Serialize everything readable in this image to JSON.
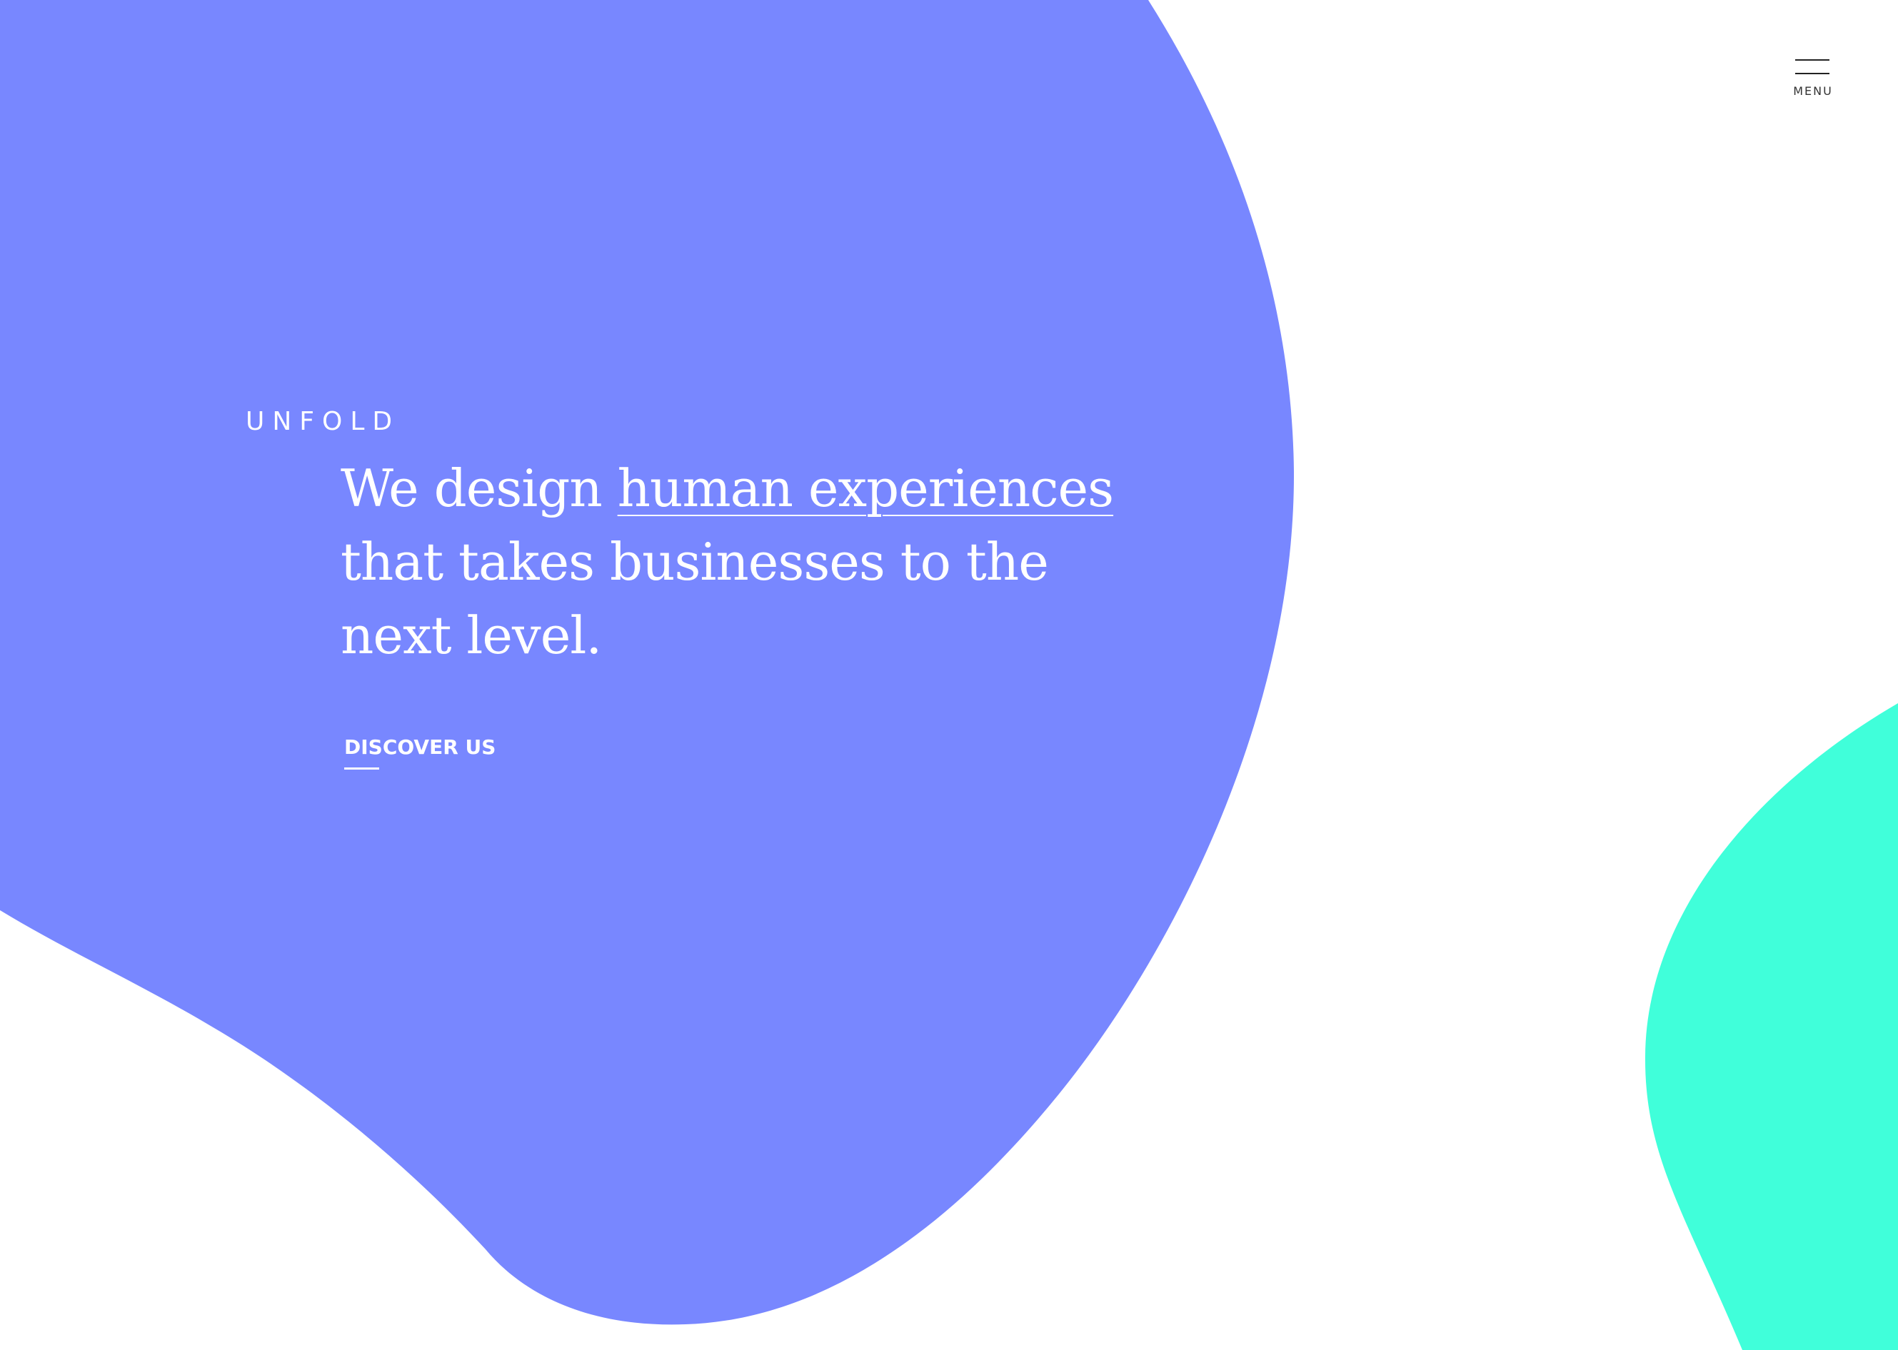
{
  "colors": {
    "primary_blob": "#7887FF",
    "accent_blob": "#40FFDA",
    "background": "#FFFFFF",
    "text_on_primary": "#FFFFFF",
    "menu_ink": "#222222"
  },
  "header": {
    "menu_icon": "hamburger-menu-icon",
    "menu_label": "MENU"
  },
  "hero": {
    "brand": "UNFOLD",
    "headline_pre": "We design ",
    "headline_highlight": "human experiences",
    "headline_post": " that takes businesses to the next level.",
    "cta_label": "DISCOVER US"
  }
}
